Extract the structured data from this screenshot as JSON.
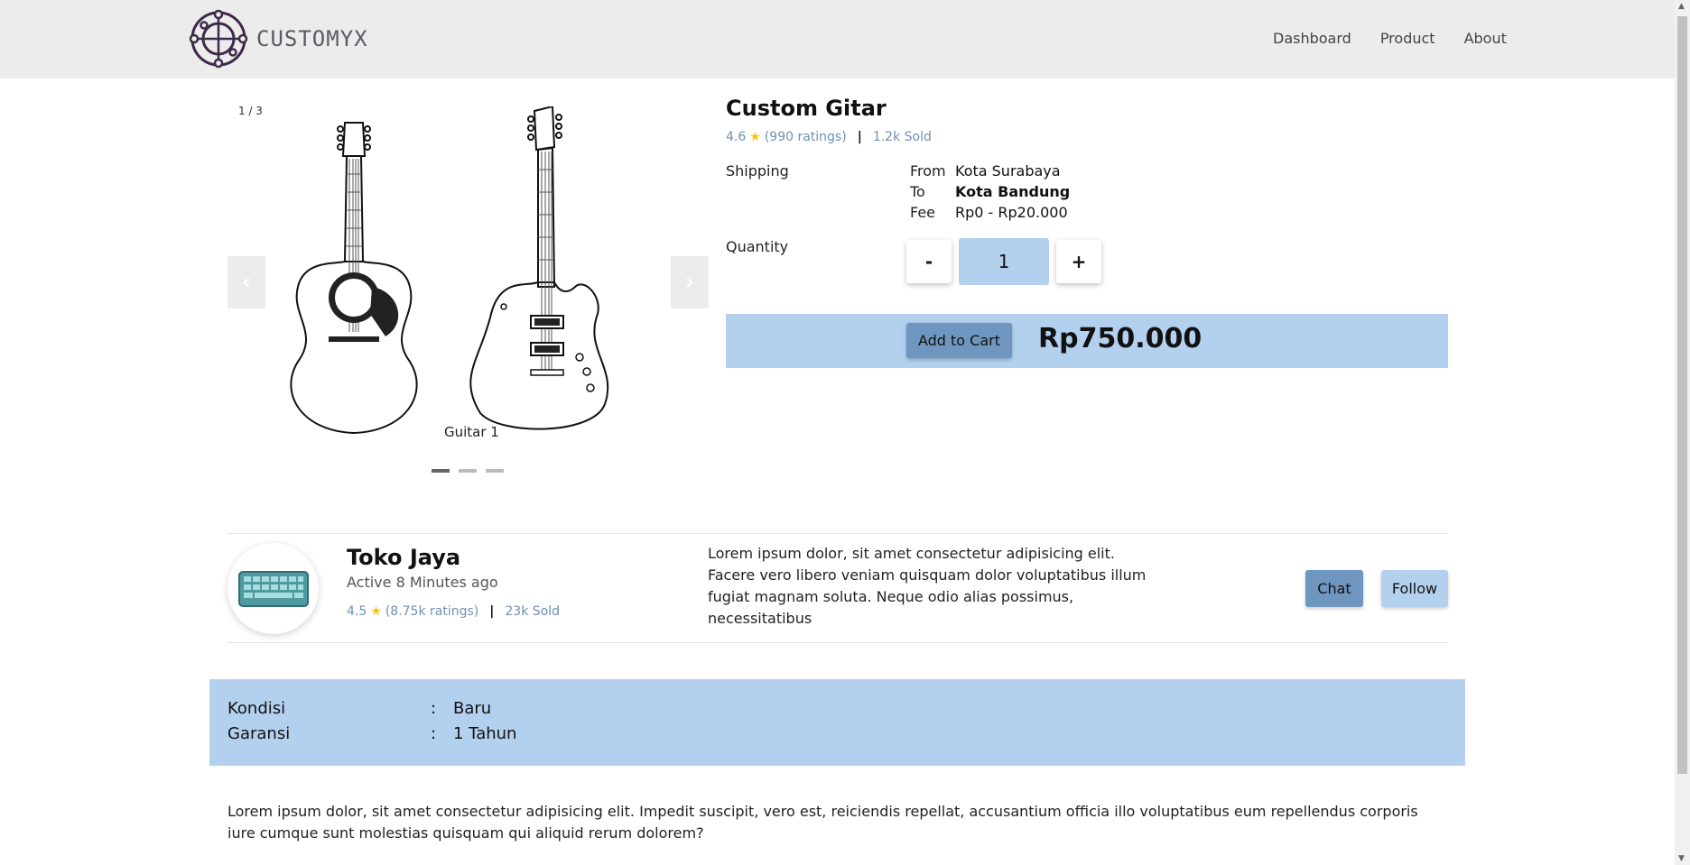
{
  "brand": {
    "name": "CUSTOMYX"
  },
  "nav": {
    "items": [
      {
        "label": "Dashboard"
      },
      {
        "label": "Product"
      },
      {
        "label": "About"
      }
    ]
  },
  "carousel": {
    "counter": "1 / 3",
    "caption": "Guitar 1",
    "prev": "‹",
    "next": "›",
    "slide_count": 3,
    "active_index": 0
  },
  "product": {
    "title": "Custom Gitar",
    "rating": "4.6",
    "ratings_count": "(990 ratings)",
    "sold": "1.2k Sold",
    "shipping": {
      "label": "Shipping",
      "from_label": "From",
      "from_value": "Kota Surabaya",
      "to_label": "To",
      "to_value": "Kota Bandung",
      "fee_label": "Fee",
      "fee_value": "Rp0 - Rp20.000"
    },
    "quantity": {
      "label": "Quantity",
      "value": "1",
      "minus": "-",
      "plus": "+"
    },
    "add_to_cart": "Add to Cart",
    "price": "Rp750.000"
  },
  "seller": {
    "name": "Toko Jaya",
    "active": "Active 8 Minutes ago",
    "rating": "4.5",
    "ratings_count": "(8.75k ratings)",
    "sold": "23k Sold",
    "description": "Lorem ipsum dolor, sit amet consectetur adipisicing elit. Facere vero libero veniam quisquam dolor voluptatibus illum fugiat magnam soluta. Neque odio alias possimus, necessitatibus",
    "chat": "Chat",
    "follow": "Follow"
  },
  "specs": {
    "condition_label": "Kondisi",
    "condition_value": "Baru",
    "warranty_label": "Garansi",
    "warranty_value": "1 Tahun",
    "separator": ":"
  },
  "description": "Lorem ipsum dolor, sit amet consectetur adipisicing elit. Impedit suscipit, vero est, reiciendis repellat, accusantium officia illo voluptatibus eum repellendus corporis iure cumque sunt molestias quisquam qui aliquid rerum dolorem?",
  "colors": {
    "accent_light": "#b3d1ef",
    "accent_dark": "#6f96bf",
    "rating_text": "#6f8fb3",
    "star": "#f5c518",
    "navbar_bg": "#ececec"
  },
  "icons": {
    "brand": "globe-logo-icon",
    "star": "star-icon",
    "avatar": "keyboard-icon",
    "prev": "chevron-left-icon",
    "next": "chevron-right-icon"
  }
}
